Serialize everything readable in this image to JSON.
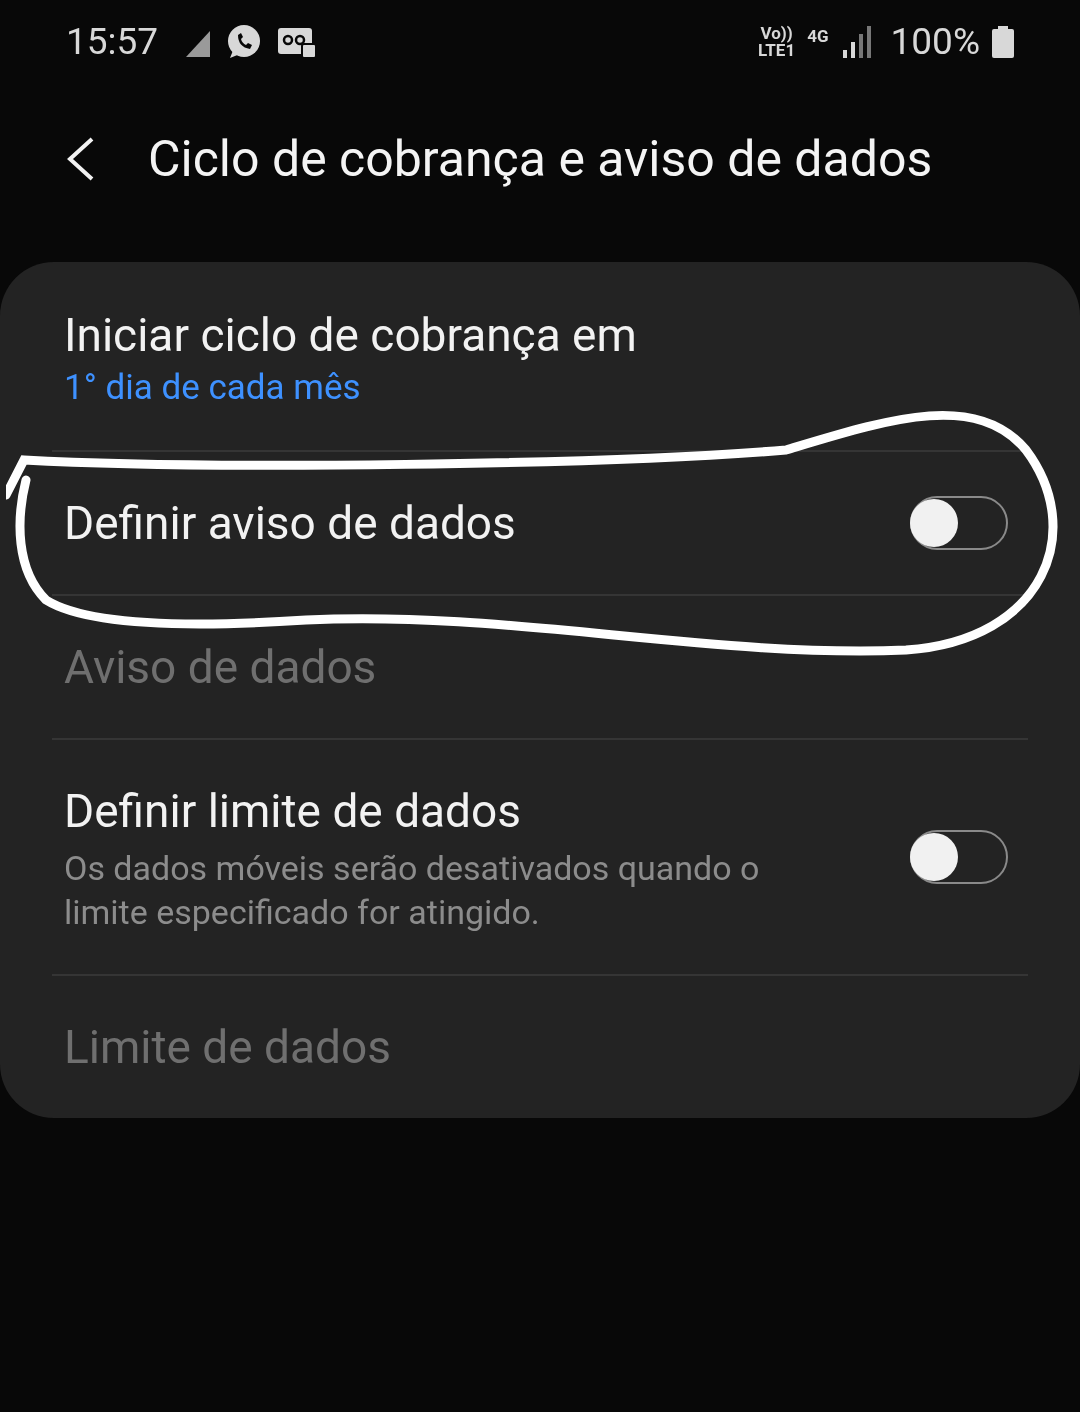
{
  "status_bar": {
    "time": "15:57",
    "volte": "Vo))",
    "lte": "LTE1",
    "network": "4G",
    "battery": "100%"
  },
  "header": {
    "title": "Ciclo de cobrança e aviso de dados"
  },
  "settings": [
    {
      "kind": "value",
      "title": "Iniciar ciclo de cobrança em",
      "value": "1° dia de cada mês",
      "disabled": false
    },
    {
      "kind": "switch",
      "title": "Definir aviso de dados",
      "on": false,
      "disabled": false
    },
    {
      "kind": "plain",
      "title": "Aviso de dados",
      "disabled": true
    },
    {
      "kind": "switch",
      "title": "Definir limite de dados",
      "subtitle": "Os dados móveis serão desativados quando o limite especificado for atingido.",
      "on": false,
      "disabled": false
    },
    {
      "kind": "plain",
      "title": "Limite de dados",
      "disabled": true
    }
  ]
}
